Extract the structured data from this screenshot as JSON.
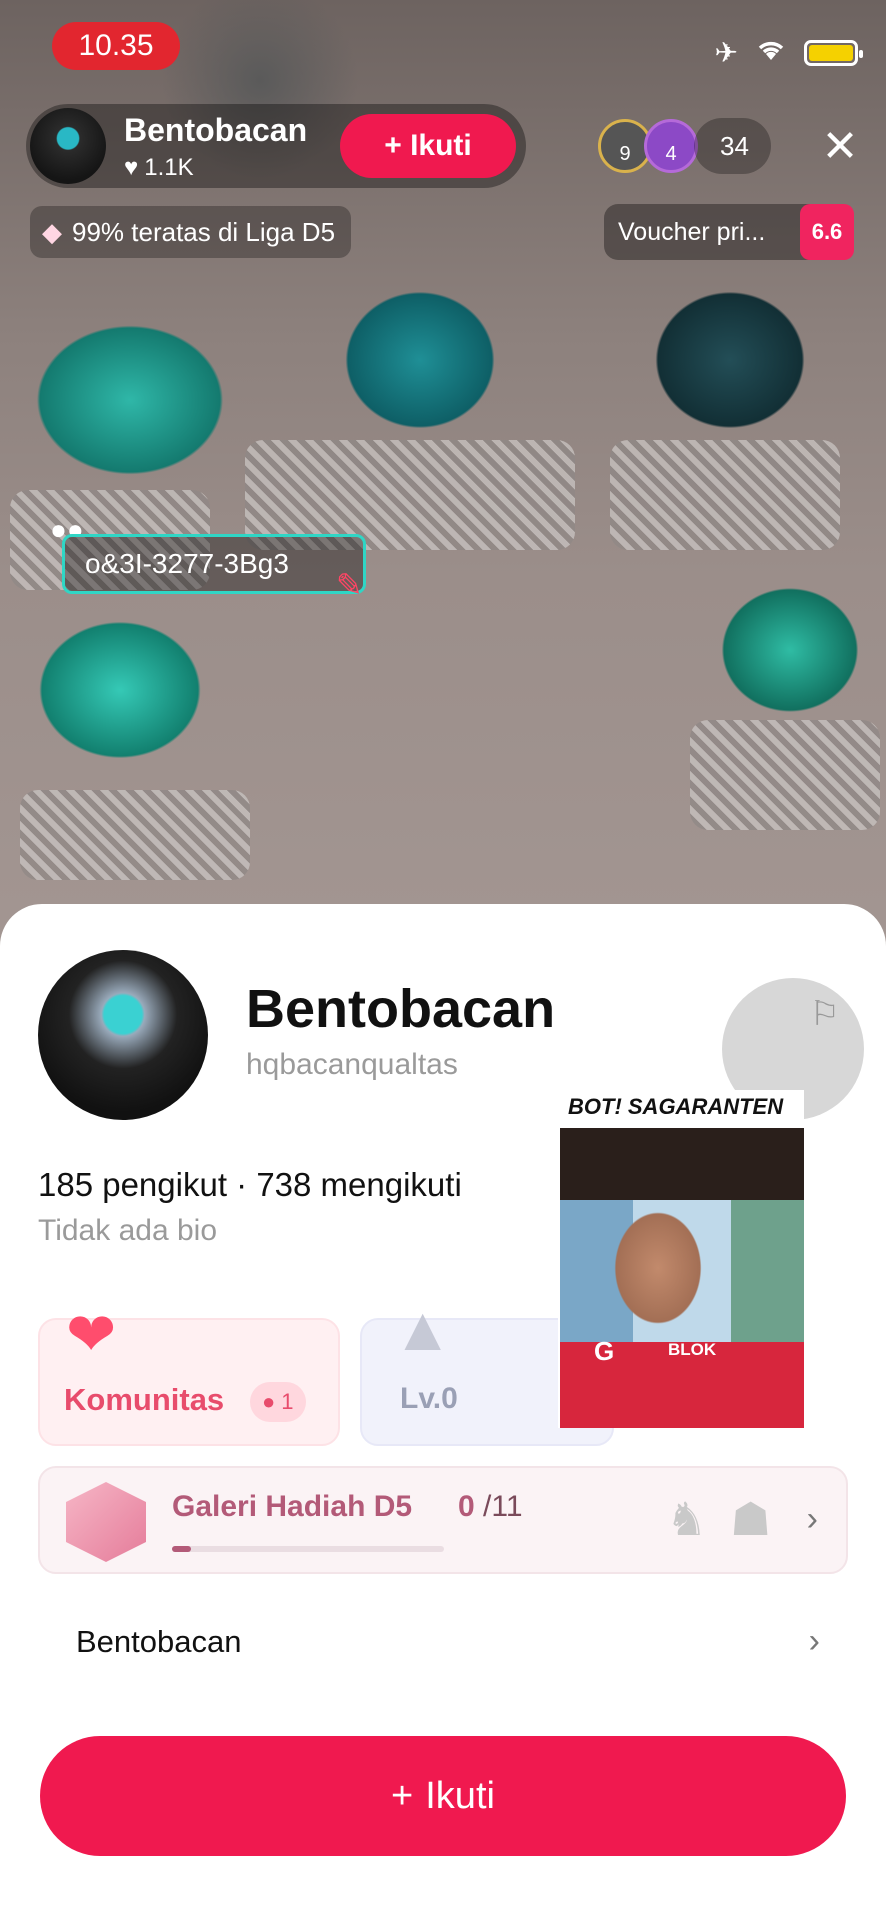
{
  "status_bar": {
    "time": "10.35"
  },
  "live_header": {
    "host_name": "Bentobacan",
    "likes": "1.1K",
    "follow_label": "+ Ikuti",
    "viewer_badges": [
      "9",
      "4"
    ],
    "viewer_count": "34",
    "league_text": "99% teratas di Liga D5",
    "voucher_text": "Voucher pri...",
    "voucher_badge": "6.6"
  },
  "pinned_comment": {
    "text": "o&3I-3277-3Bg3"
  },
  "profile": {
    "name": "Bentobacan",
    "handle": "hqbacanqualtas",
    "stats": "185 pengikut · 738 mengikuti",
    "bio": "Tidak ada bio"
  },
  "community": {
    "label": "Komunitas",
    "count": "1"
  },
  "level": {
    "label": "Lv.0"
  },
  "meme_overlay": {
    "title": "BOT! SAGARANTEN",
    "caption_left": "G",
    "caption_right": "BLOK"
  },
  "gallery": {
    "title": "Galeri Hadiah D5",
    "current": "0",
    "total": "/11",
    "progress": 0.07
  },
  "name_row": {
    "label": "Bentobacan"
  },
  "follow_button": {
    "label": "Ikuti",
    "plus": "+"
  },
  "colors": {
    "accent": "#f0194f",
    "community": "#e84c6c",
    "gallery": "#b35a78"
  }
}
